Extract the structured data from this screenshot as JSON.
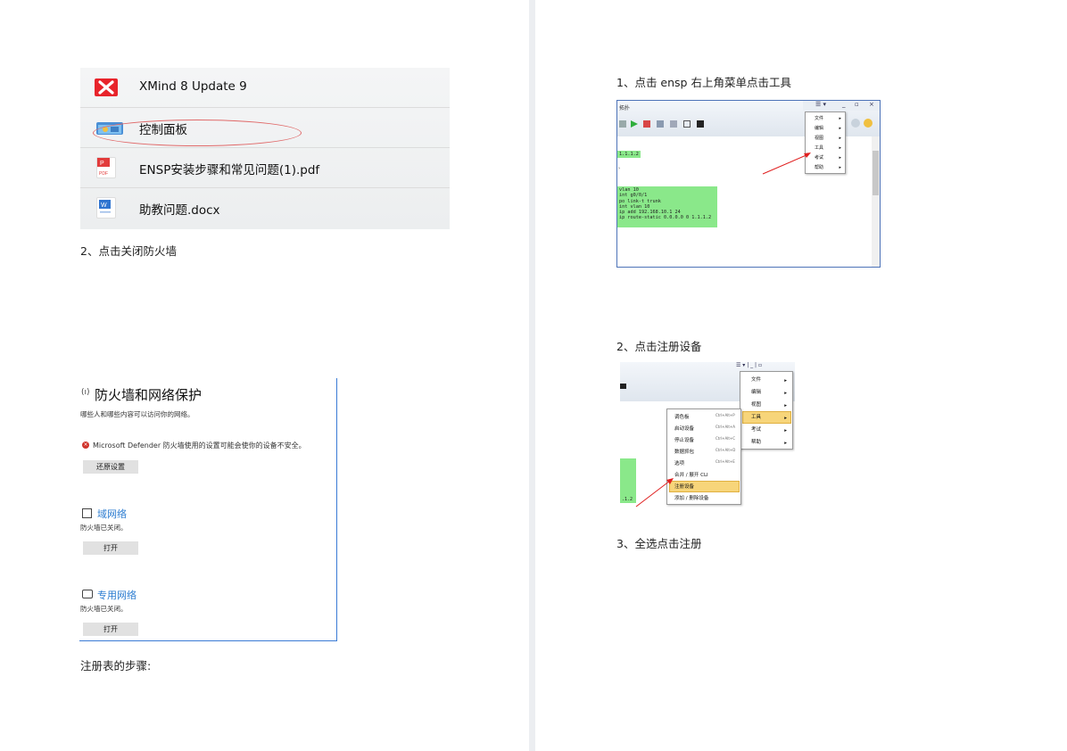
{
  "left_page": {
    "file_list": {
      "items": [
        {
          "label": "XMind 8 Update 9",
          "icon": "xmind-icon"
        },
        {
          "label": "控制面板",
          "icon": "control-panel-icon"
        },
        {
          "label": "ENSP安装步骤和常见问题(1).pdf",
          "icon": "pdf-icon"
        },
        {
          "label": "助教问题.docx",
          "icon": "word-icon"
        }
      ]
    },
    "step2_caption": "2、点击关闭防火墙",
    "firewall_panel": {
      "title": "防火墙和网络保护",
      "subtitle": "哪些人和哪些内容可以访问你的网络。",
      "warning": "Microsoft Defender 防火墙使用的设置可能会使你的设备不安全。",
      "restore_button": "还原设置",
      "domain_network": {
        "label": "域网络",
        "status": "防火墙已关闭。",
        "button": "打开"
      },
      "private_network": {
        "label": "专用网络",
        "status": "防火墙已关闭。",
        "button": "打开"
      }
    },
    "registry_caption": "注册表的步骤:"
  },
  "right_page": {
    "step1_caption": "1、点击 ensp 右上角菜单点击工具",
    "ensp_window": {
      "title": "拓扑",
      "code_short": "1.1.1.2",
      "code_block": "vlan 10\nint g0/0/1\npo link-t trunk\nint vlan 10\nip add 192.168.10.1 24\nip route-static 0.0.0.0 0 1.1.1.2",
      "menu_items": [
        "文件",
        "编辑",
        "视图",
        "工具",
        "考试",
        "帮助"
      ]
    },
    "step2_caption": "2、点击注册设备",
    "ensp_window2": {
      "menu_items": [
        "文件",
        "编辑",
        "视图",
        "工具",
        "考试",
        "帮助"
      ],
      "submenu": [
        {
          "label": "调色板",
          "shortcut": "Ctrl+Alt+P"
        },
        {
          "label": "启动设备",
          "shortcut": "Ctrl+Alt+A"
        },
        {
          "label": "停止设备",
          "shortcut": "Ctrl+Alt+C"
        },
        {
          "label": "数据抓包",
          "shortcut": "Ctrl+Alt+D"
        },
        {
          "label": "选项",
          "shortcut": "Ctrl+Alt+E"
        },
        {
          "label": "合并 / 展开 CLI",
          "shortcut": ""
        },
        {
          "label": "注册设备",
          "shortcut": ""
        },
        {
          "label": "添加 / 删除设备",
          "shortcut": ""
        }
      ],
      "code_short": ".1.2"
    },
    "step3_caption": "3、全选点击注册"
  },
  "colors": {
    "accent_blue": "#2a7bd0",
    "code_green": "#8ae88a",
    "highlight": "#f7d57a",
    "arrow_red": "#e02020"
  }
}
